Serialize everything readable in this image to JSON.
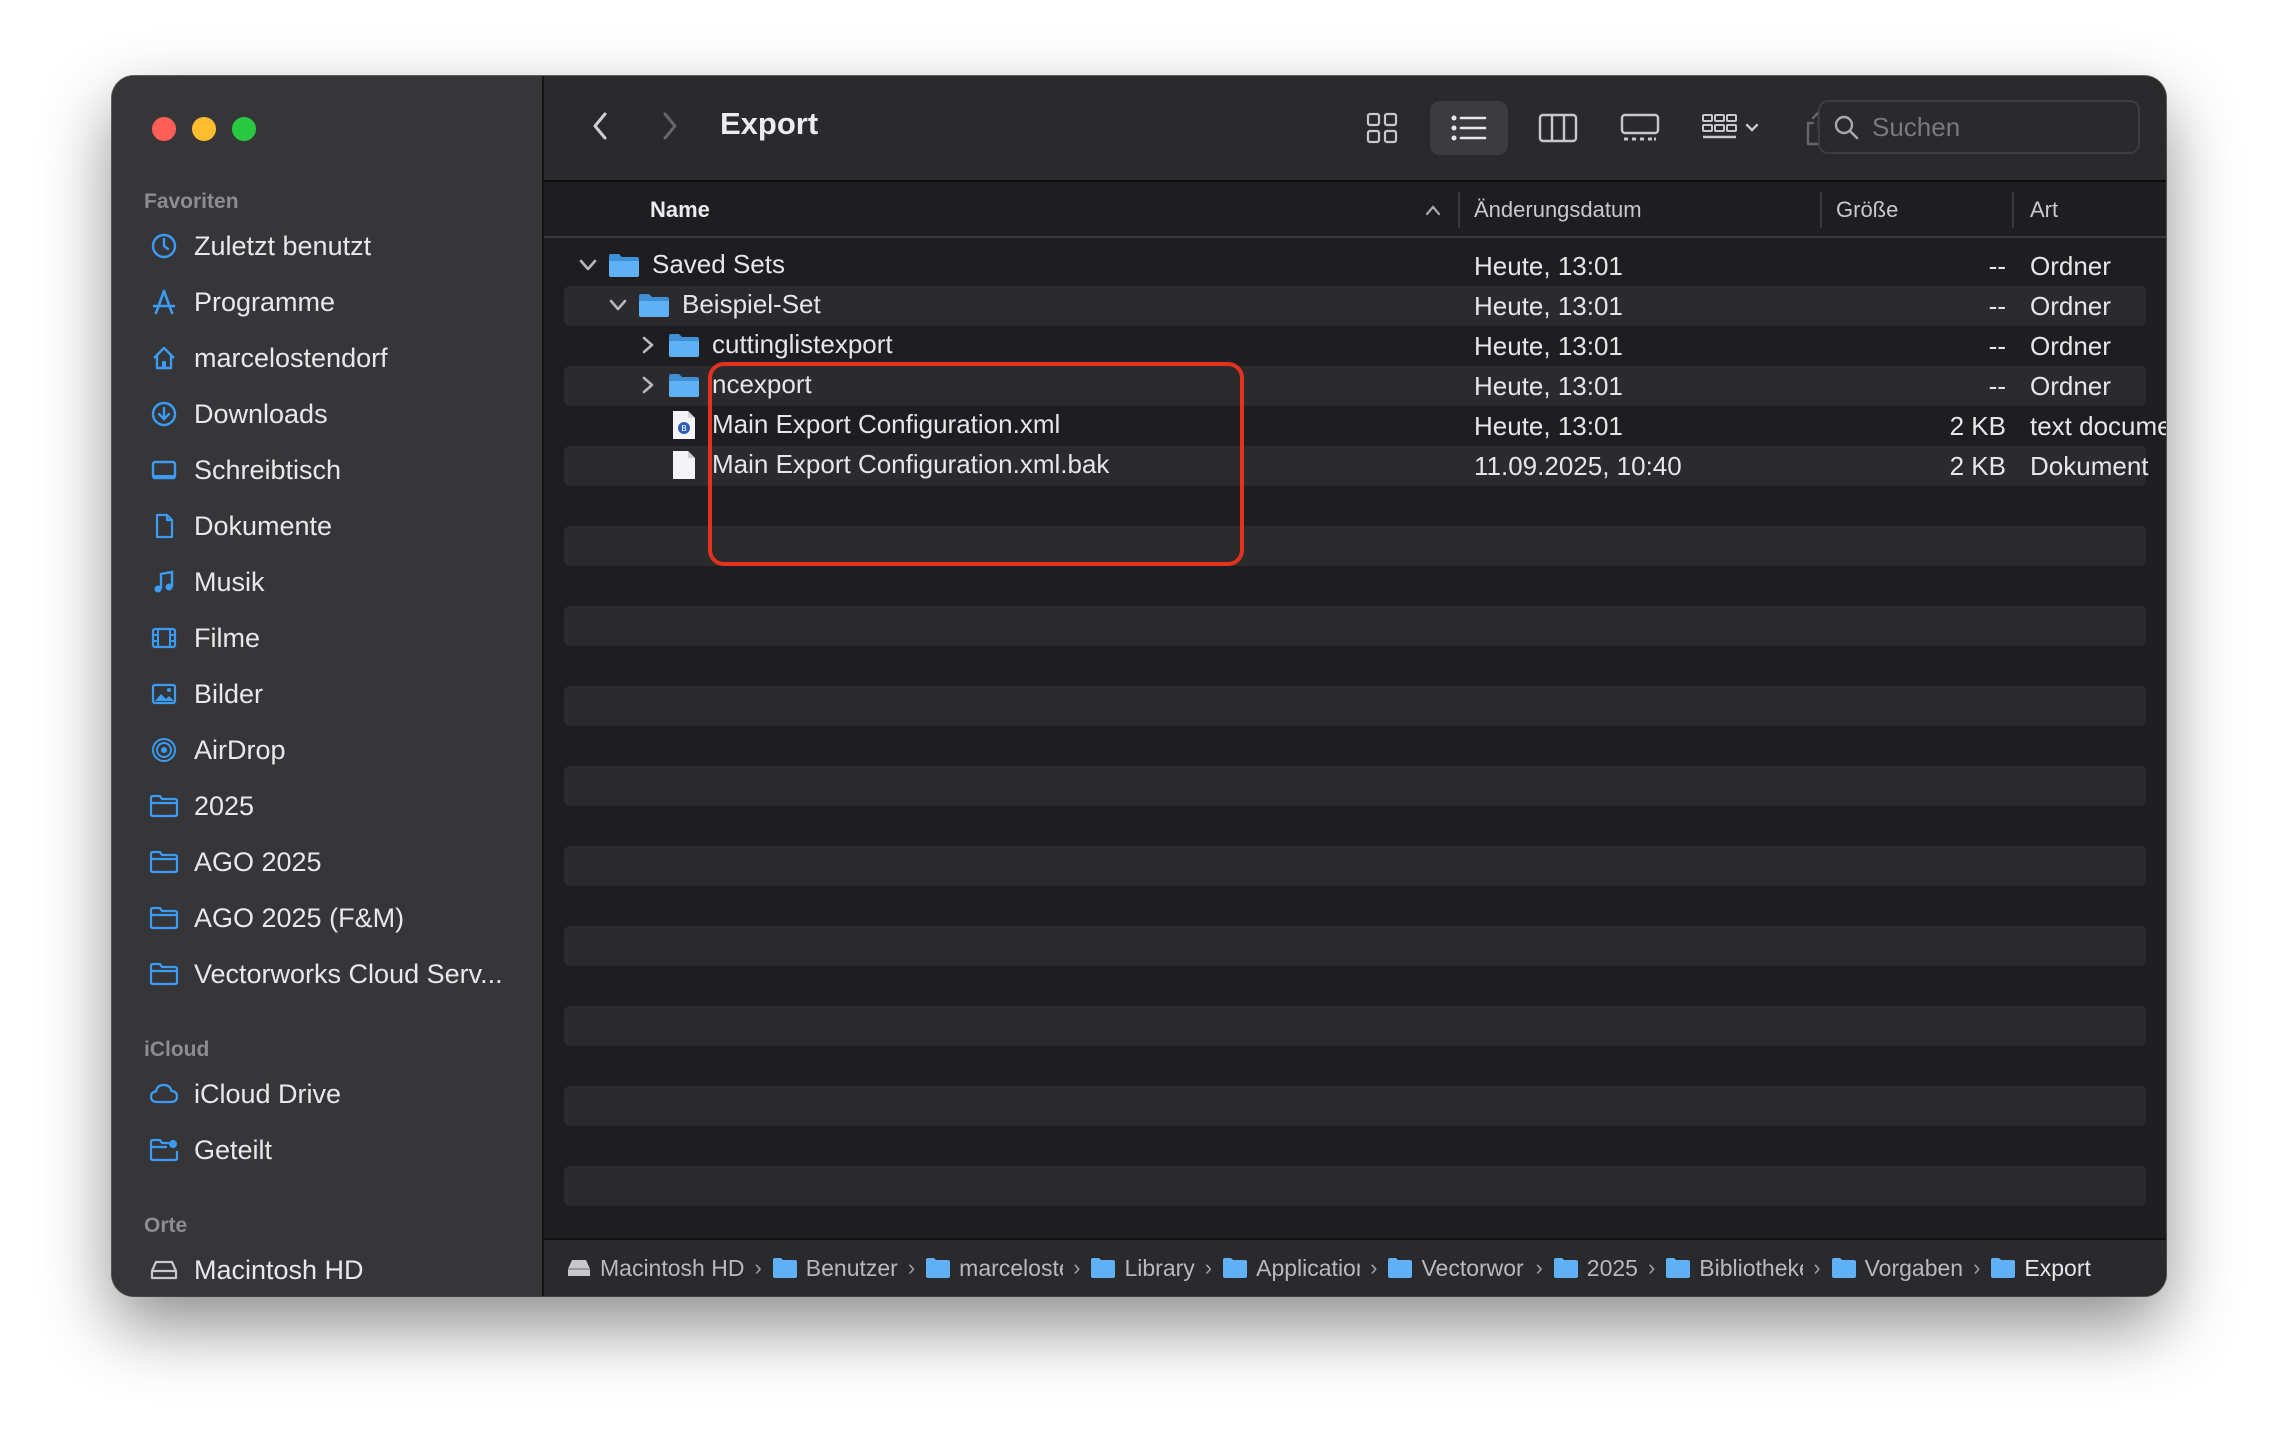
{
  "window": {
    "title": "Export"
  },
  "sidebar": {
    "sections": [
      {
        "title": "Favoriten",
        "items": [
          {
            "label": "Zuletzt benutzt",
            "icon": "clock-icon"
          },
          {
            "label": "Programme",
            "icon": "apps-icon"
          },
          {
            "label": "marcelostendorf",
            "icon": "home-icon"
          },
          {
            "label": "Downloads",
            "icon": "download-icon"
          },
          {
            "label": "Schreibtisch",
            "icon": "desktop-icon"
          },
          {
            "label": "Dokumente",
            "icon": "document-icon"
          },
          {
            "label": "Musik",
            "icon": "music-icon"
          },
          {
            "label": "Filme",
            "icon": "film-icon"
          },
          {
            "label": "Bilder",
            "icon": "photo-icon"
          },
          {
            "label": "AirDrop",
            "icon": "airdrop-icon"
          },
          {
            "label": "2025",
            "icon": "folder-icon"
          },
          {
            "label": "AGO 2025",
            "icon": "folder-icon"
          },
          {
            "label": "AGO 2025 (F&M)",
            "icon": "folder-icon"
          },
          {
            "label": "Vectorworks Cloud Serv...",
            "icon": "folder-icon"
          }
        ]
      },
      {
        "title": "iCloud",
        "items": [
          {
            "label": "iCloud Drive",
            "icon": "cloud-icon"
          },
          {
            "label": "Geteilt",
            "icon": "shared-folder-icon"
          }
        ]
      },
      {
        "title": "Orte",
        "items": [
          {
            "label": "Macintosh HD",
            "icon": "disk-icon"
          }
        ]
      }
    ]
  },
  "search": {
    "placeholder": "Suchen"
  },
  "columns": {
    "name": "Name",
    "date": "Änderungsdatum",
    "size": "Größe",
    "kind": "Art"
  },
  "files": [
    {
      "name": "Saved Sets",
      "date": "Heute, 13:01",
      "size": "--",
      "kind": "Ordner",
      "type": "folder",
      "depth": 0,
      "expanded": true
    },
    {
      "name": "Beispiel-Set",
      "date": "Heute, 13:01",
      "size": "--",
      "kind": "Ordner",
      "type": "folder",
      "depth": 1,
      "expanded": true
    },
    {
      "name": "cuttinglistexport",
      "date": "Heute, 13:01",
      "size": "--",
      "kind": "Ordner",
      "type": "folder",
      "depth": 2,
      "expanded": false
    },
    {
      "name": "ncexport",
      "date": "Heute, 13:01",
      "size": "--",
      "kind": "Ordner",
      "type": "folder",
      "depth": 2,
      "expanded": false
    },
    {
      "name": "Main Export Configuration.xml",
      "date": "Heute, 13:01",
      "size": "2 KB",
      "kind": "text document",
      "type": "xml",
      "depth": 2
    },
    {
      "name": "Main Export Configuration.xml.bak",
      "date": "11.09.2025, 10:40",
      "size": "2 KB",
      "kind": "Dokument",
      "type": "doc",
      "depth": 2
    }
  ],
  "pathbar": [
    {
      "label": "Macintosh HD",
      "icon": "disk-icon"
    },
    {
      "label": "Benutzer",
      "icon": "folder-icon"
    },
    {
      "label": "marcelostendorf",
      "icon": "home-folder-icon"
    },
    {
      "label": "Library",
      "icon": "folder-icon"
    },
    {
      "label": "Application Support",
      "icon": "folder-icon"
    },
    {
      "label": "Vectorworks",
      "icon": "folder-icon"
    },
    {
      "label": "2025",
      "icon": "folder-icon"
    },
    {
      "label": "Bibliotheken",
      "icon": "folder-icon"
    },
    {
      "label": "Vorgaben",
      "icon": "folder-icon"
    },
    {
      "label": "Export",
      "icon": "folder-icon"
    }
  ],
  "colors": {
    "accent": "#3a9cf5",
    "folder": "#56a9f1",
    "highlight": "#e0321e"
  }
}
